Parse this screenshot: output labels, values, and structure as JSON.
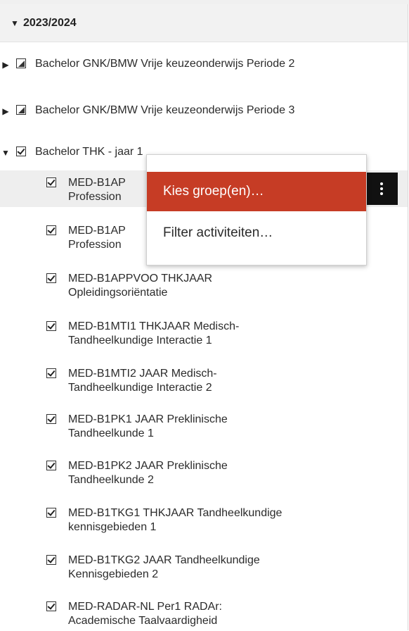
{
  "year_header": {
    "label": "2023/2024"
  },
  "groups": [
    {
      "label": "Bachelor GNK/BMW Vrije keuzeonderwijs Periode 2",
      "state": "partial"
    },
    {
      "label": "Bachelor GNK/BMW Vrije keuzeonderwijs Periode 3",
      "state": "partial"
    },
    {
      "label": "Bachelor THK - jaar 1",
      "state": "checked"
    }
  ],
  "courses": [
    {
      "label": "MED-B1APP THKJAAR Academische en Professionele Vorming",
      "visible_label": "MED-B1AP\nProfession"
    },
    {
      "label": "MED-B1APP THKJAAR Academische en Professionele Vorming",
      "visible_label": "MED-B1AP\nProfession"
    },
    {
      "label": "MED-B1APPVOO THKJAAR\nOpleidingsoriëntatie"
    },
    {
      "label": "MED-B1MTI1 THKJAAR Medisch-\nTandheelkundige Interactie 1"
    },
    {
      "label": "MED-B1MTI2 JAAR Medisch-\nTandheelkundige Interactie 2"
    },
    {
      "label": "MED-B1PK1 JAAR Preklinische\nTandheelkunde 1"
    },
    {
      "label": "MED-B1PK2 JAAR Preklinische\nTandheelkunde 2"
    },
    {
      "label": "MED-B1TKG1 THKJAAR Tandheelkundige\nkennisgebieden 1"
    },
    {
      "label": "MED-B1TKG2 JAAR Tandheelkundige\nKennisgebieden 2"
    },
    {
      "label": "MED-RADAR-NL Per1 RADAr:\nAcademische Taalvaardigheid"
    }
  ],
  "context_menu": {
    "items": [
      {
        "label": "Kies groep(en)…",
        "active": true
      },
      {
        "label": "Filter activiteiten…",
        "active": false
      }
    ]
  },
  "icons": {
    "expand": "caret-right-icon",
    "collapse": "caret-down-icon",
    "more": "kebab-menu-icon",
    "checkbox": "checkbox-icon"
  },
  "colors": {
    "accent": "#c63c25",
    "header_bg": "#f2f2f2",
    "hover_bg": "#eeeeee",
    "kebab_bg": "#111111"
  }
}
